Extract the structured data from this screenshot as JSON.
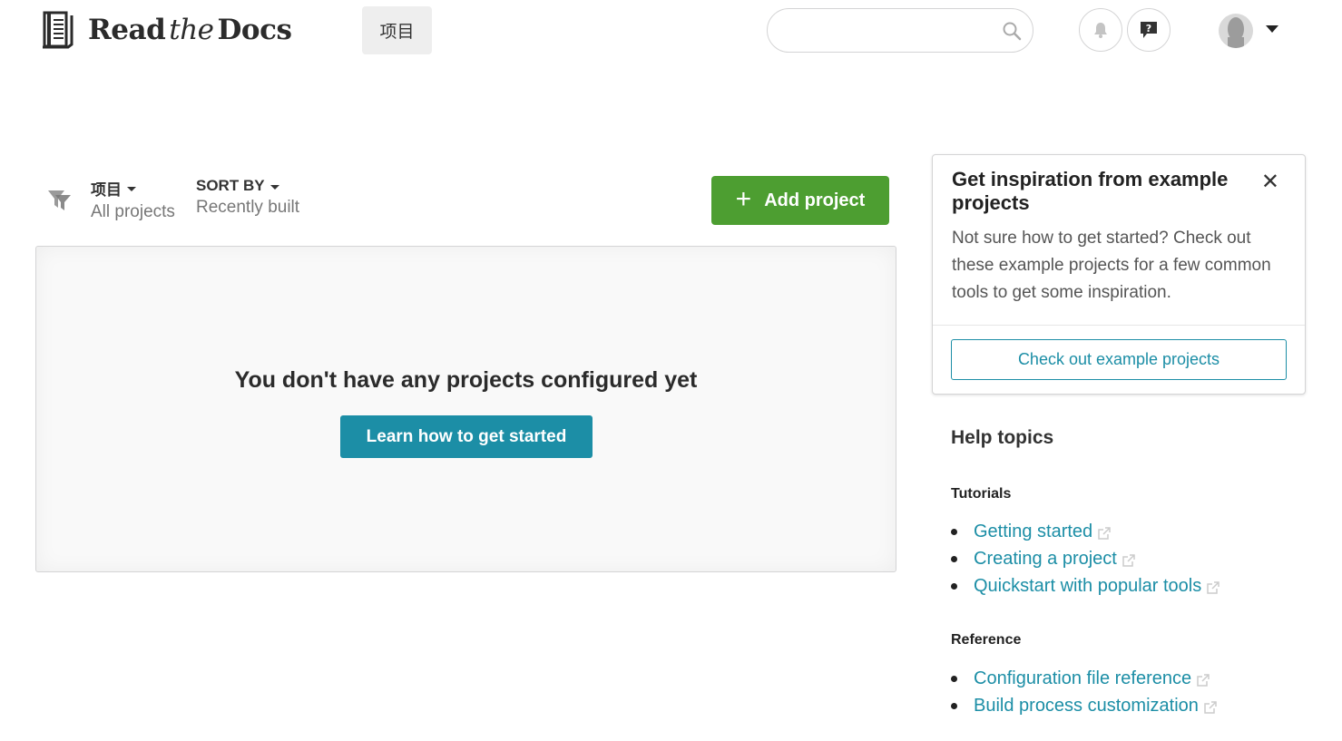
{
  "header": {
    "logo": {
      "word1": "Read",
      "word2": "the",
      "word3": "Docs"
    },
    "nav_projects_label": "项目",
    "search_placeholder": "",
    "icons": [
      "book-logo-icon",
      "search-icon",
      "bell-icon",
      "help-icon",
      "avatar",
      "caret-down-icon"
    ]
  },
  "filters": {
    "projects": {
      "label": "项目",
      "value": "All projects"
    },
    "sort": {
      "label": "SORT BY",
      "value": "Recently built"
    }
  },
  "add_project": {
    "label": "Add project",
    "color": "#4d9e31"
  },
  "empty_state": {
    "title": "You don't have any projects configured yet",
    "button_label": "Learn how to get started",
    "button_color": "#1c8ea6"
  },
  "inspiration": {
    "title": "Get inspiration from example projects",
    "close_glyph": "✕",
    "text": "Not sure how to get started? Check out these example projects for a few common tools to get some inspiration.",
    "button_label": "Check out example projects"
  },
  "help": {
    "heading": "Help topics",
    "sections": [
      {
        "title": "Tutorials",
        "links": [
          "Getting started",
          "Creating a project",
          "Quickstart with popular tools"
        ]
      },
      {
        "title": "Reference",
        "links": [
          "Configuration file reference",
          "Build process customization"
        ]
      }
    ]
  },
  "colors": {
    "link": "#1c8ea6",
    "green": "#4d9e31",
    "text": "#333333"
  }
}
